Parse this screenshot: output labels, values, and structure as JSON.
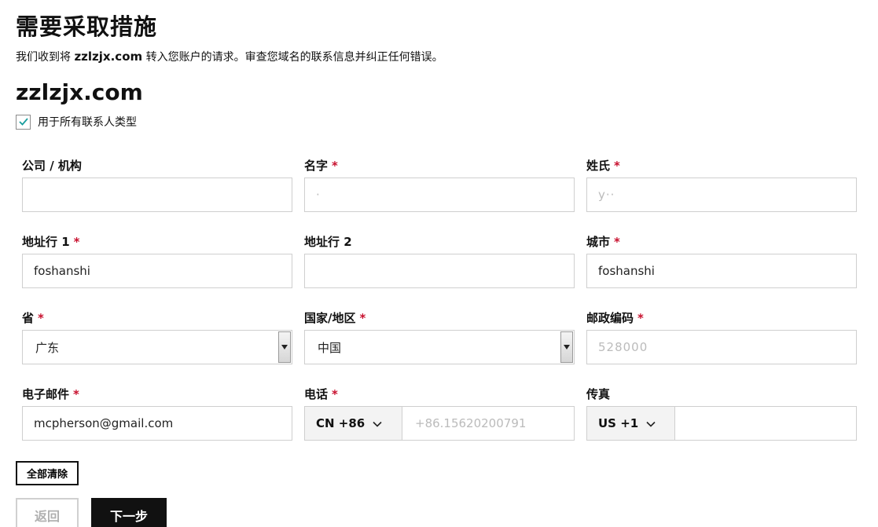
{
  "header": {
    "title": "需要采取措施",
    "subtitle_prefix": "我们收到将 ",
    "subtitle_domain": "zzlzjx.com",
    "subtitle_suffix": " 转入您账户的请求。审查您域名的联系信息并纠正任何错误。"
  },
  "domain_heading": "zzlzjx.com",
  "apply_all": {
    "label": "用于所有联系人类型",
    "checked": true
  },
  "form": {
    "company": {
      "label": "公司 / 机构",
      "value": ""
    },
    "first_name": {
      "label": "名字",
      "required": "*",
      "value": "·"
    },
    "last_name": {
      "label": "姓氏",
      "required": "*",
      "value": "y··"
    },
    "address1": {
      "label": "地址行 1",
      "required": "*",
      "value": "foshanshi"
    },
    "address2": {
      "label": "地址行 2",
      "value": ""
    },
    "city": {
      "label": "城市",
      "required": "*",
      "value": "foshanshi"
    },
    "province": {
      "label": "省",
      "required": "*",
      "value": "广东"
    },
    "country": {
      "label": "国家/地区",
      "required": "*",
      "value": "中国"
    },
    "postal": {
      "label": "邮政编码",
      "required": "*",
      "value": "528000"
    },
    "email": {
      "label": "电子邮件",
      "required": "*",
      "value": "mcpherson@gmail.com"
    },
    "phone": {
      "label": "电话",
      "required": "*",
      "country_code": "CN +86",
      "value": "+86.15620200791"
    },
    "fax": {
      "label": "传真",
      "country_code": "US +1",
      "value": ""
    }
  },
  "buttons": {
    "clear": "全部清除",
    "back": "返回",
    "next": "下一步"
  },
  "colors": {
    "required_marker": "#c8102e",
    "checkbox_check": "#1a9e9e",
    "primary_button": "#111111"
  }
}
